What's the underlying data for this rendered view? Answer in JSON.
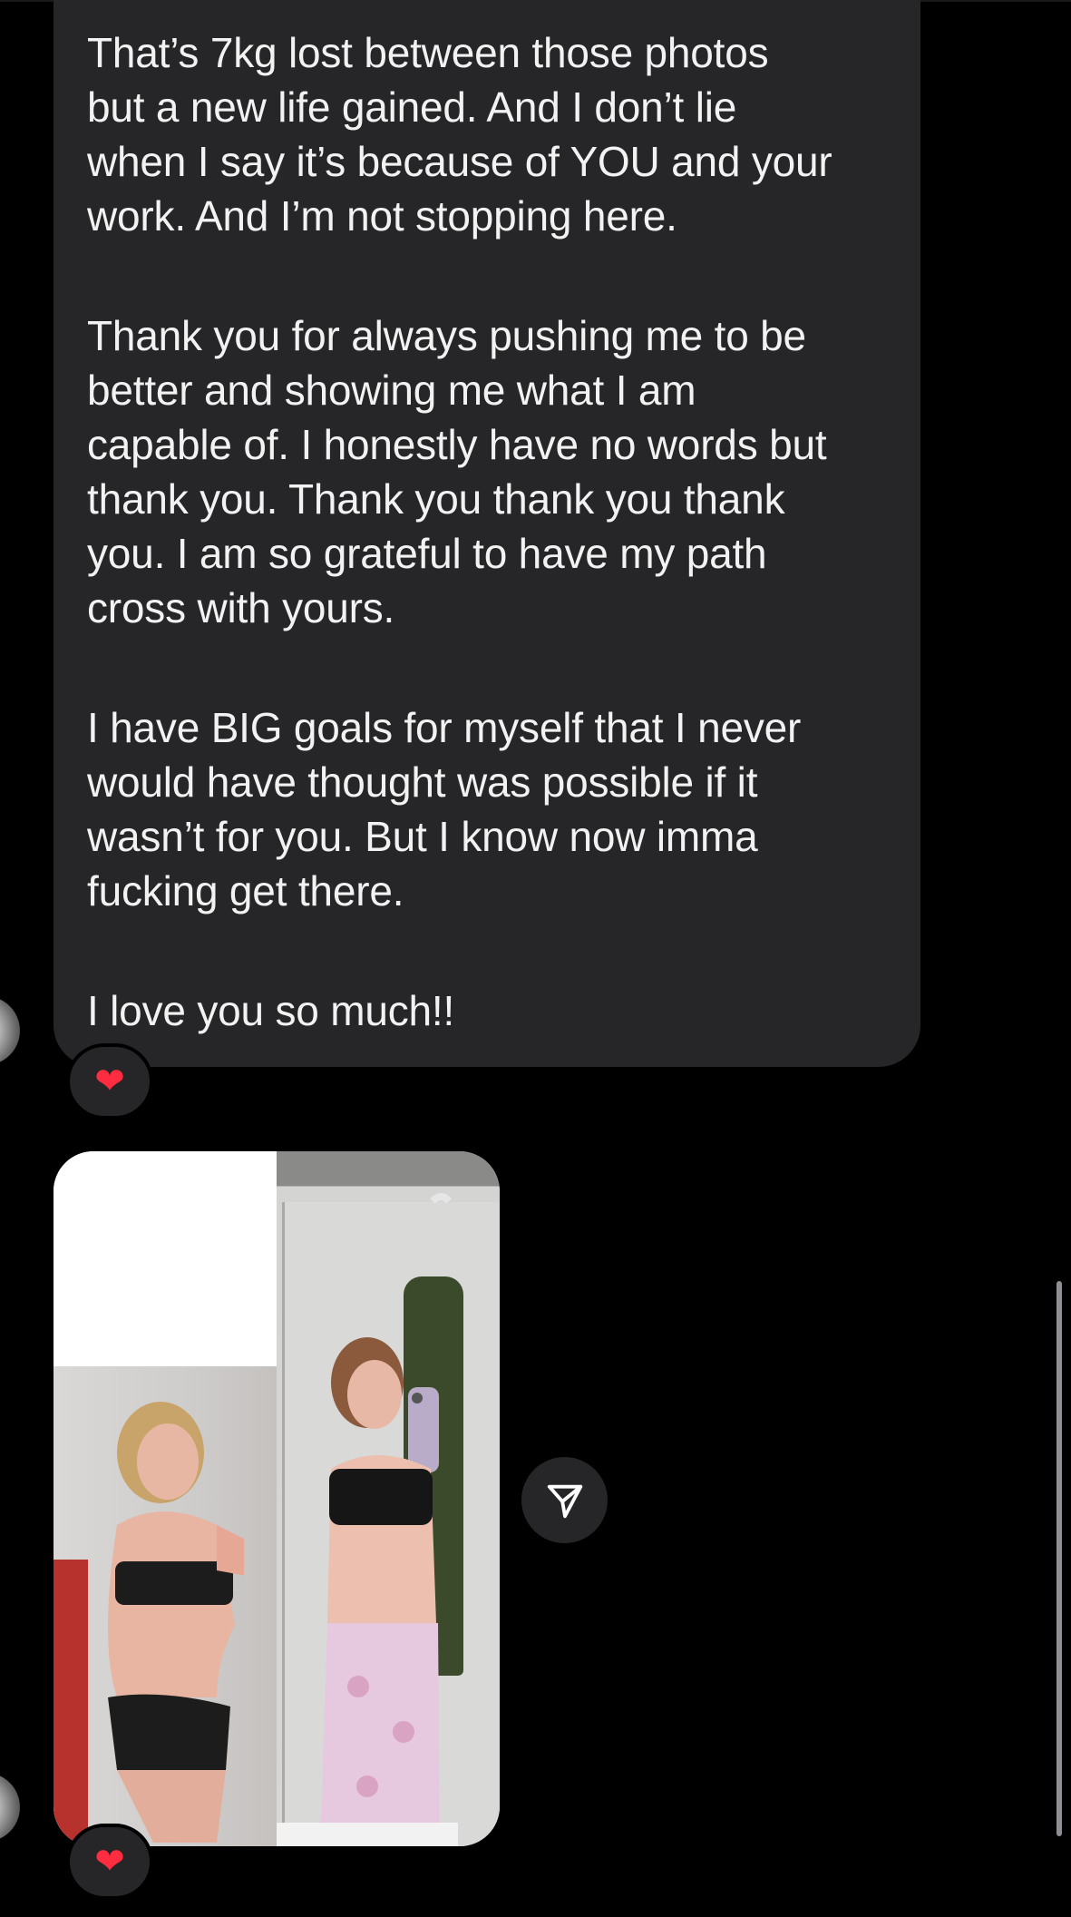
{
  "message": {
    "paragraphs": [
      "That’s 7kg lost between those photos\nbut a new life gained. And I don’t lie\nwhen I say it’s because of YOU and your\nwork. And I’m not stopping here.",
      "Thank you for always pushing me to be\nbetter and showing me what I am\ncapable of. I honestly have no words but\nthank you. Thank you thank you thank\nyou. I am so grateful to have my path\ncross with yours.",
      "I have BIG goals for myself that I never\nwould have thought was possible if it\nwasn’t for you. But I know now imma\nfucking get there.",
      "I love you so much!!"
    ],
    "reaction": "❤"
  },
  "photo_message": {
    "reaction": "❤"
  },
  "colors": {
    "background": "#000000",
    "bubble": "#262628",
    "text": "#f2f2f2",
    "heart": "#ff2d3f"
  },
  "icons": {
    "share": "paper-plane-icon",
    "reaction": "heart-icon"
  }
}
